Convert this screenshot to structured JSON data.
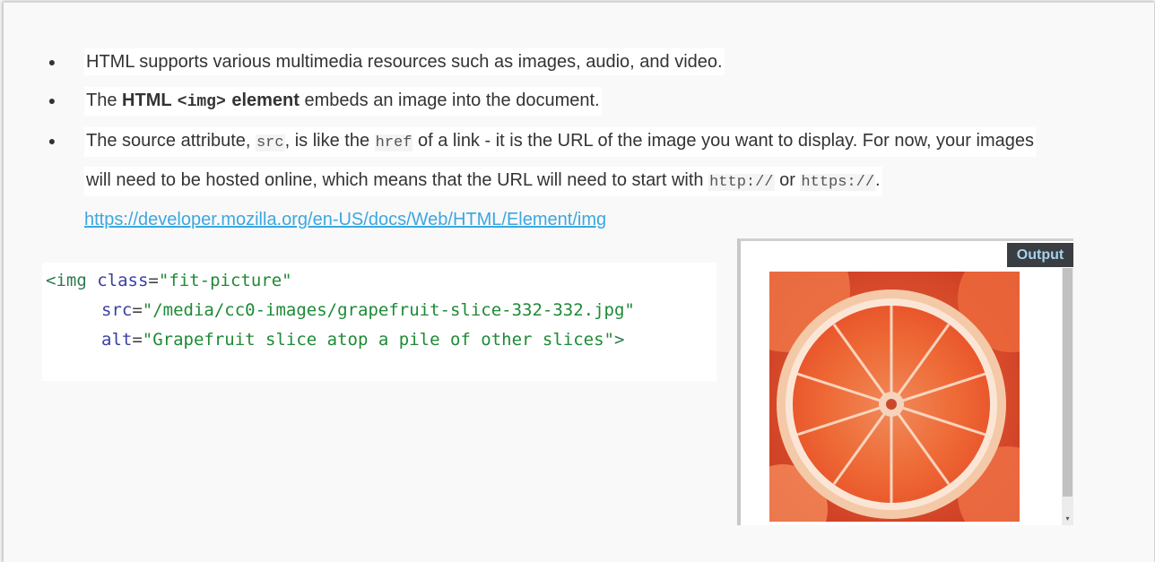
{
  "bullets": [
    {
      "text": "HTML supports various multimedia resources such as images, audio, and video."
    },
    {
      "pre": "The ",
      "bold_a": "HTML ",
      "bold_code": "<img>",
      "bold_b": " element",
      "post": " embeds an image into the document."
    },
    {
      "line1_a": "The source attribute, ",
      "code_src": "src",
      "line1_b": ", is like the ",
      "code_href": "href",
      "line1_c": " of a link - it is the URL of the image you want to display. For now, your images",
      "line2_a": "will need to be hosted online, which means that the URL will need to start with ",
      "code_http": "http://",
      "line2_or": " or ",
      "code_https": "https://",
      "line2_end": ".",
      "link": "https://developer.mozilla.org/en-US/docs/Web/HTML/Element/img"
    }
  ],
  "code": {
    "line1": {
      "open": "<img",
      "attr": "class",
      "eq": "=",
      "val": "\"fit-picture\""
    },
    "line2": {
      "attr": "src",
      "eq": "=",
      "val": "\"/media/cc0-images/grapefruit-slice-332-332.jpg\""
    },
    "line3": {
      "attr": "alt",
      "eq": "=",
      "val": "\"Grapefruit slice atop a pile of other slices\"",
      "close": ">"
    }
  },
  "output": {
    "label": "Output",
    "image_icon": "grapefruit-slice-image",
    "scroll_arrow": "▾"
  },
  "colors": {
    "link": "#3ba7e0",
    "output_label_bg": "#3a3d41",
    "output_label_text": "#a7d3ec",
    "code_attr": "#3a40a3",
    "code_value": "#1e8a36"
  }
}
